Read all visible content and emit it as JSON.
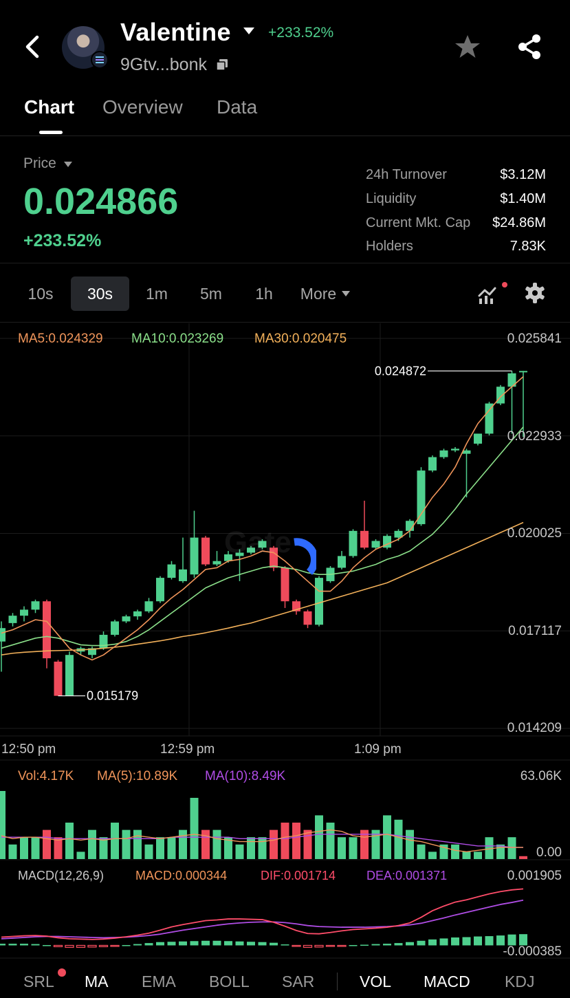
{
  "header": {
    "token_name": "Valentine",
    "change": "+233.52%",
    "address": "9Gtv...bonk"
  },
  "tabs": [
    "Chart",
    "Overview",
    "Data"
  ],
  "price": {
    "label": "Price",
    "value": "0.024866",
    "change": "+233.52%"
  },
  "stats": [
    {
      "label": "24h Turnover",
      "value": "$3.12M"
    },
    {
      "label": "Liquidity",
      "value": "$1.40M"
    },
    {
      "label": "Current Mkt. Cap",
      "value": "$24.86M"
    },
    {
      "label": "Holders",
      "value": "7.83K"
    }
  ],
  "intervals": [
    "10s",
    "30s",
    "1m",
    "5m",
    "1h",
    "More"
  ],
  "selected_interval": "30s",
  "ma_legend": {
    "ma5": "MA5:0.024329",
    "ma10": "MA10:0.023269",
    "ma30": "MA30:0.020475"
  },
  "price_axis": [
    "0.025841",
    "0.022933",
    "0.020025",
    "0.017117",
    "0.014209"
  ],
  "high_marker": "0.024872",
  "low_marker": "0.015179",
  "time_axis": [
    "12:50 pm",
    "12:59 pm",
    "1:09 pm"
  ],
  "watermark": "Gate",
  "volume_legend": {
    "vol": "Vol:4.17K",
    "ma5": "MA(5):10.89K",
    "ma10": "MA(10):8.49K",
    "max": "63.06K",
    "min": "0.00"
  },
  "macd_legend": {
    "name": "MACD(12,26,9)",
    "macd": "MACD:0.000344",
    "dif": "DIF:0.001714",
    "dea": "DEA:0.001371",
    "max": "0.001905",
    "min": "-0.000385"
  },
  "bottom_indicators": [
    "SRL",
    "MA",
    "EMA",
    "BOLL",
    "SAR",
    "VOL",
    "MACD",
    "KDJ"
  ],
  "colors": {
    "up": "#4fd08e",
    "down": "#ef4b5b",
    "ma5": "#f0955a",
    "ma10": "#8be08a",
    "ma30": "#f3b15a",
    "vol_ma10": "#b04de6",
    "dif": "#ff4d6a",
    "dea": "#b04de6"
  },
  "chart_data": {
    "type": "candlestick",
    "title": "",
    "ylim": [
      0.014209,
      0.025841
    ],
    "y_ticks": [
      0.025841,
      0.022933,
      0.020025,
      0.017117,
      0.014209
    ],
    "x_ticks": [
      "12:50 pm",
      "12:59 pm",
      "1:09 pm"
    ],
    "candles": [
      {
        "open": 0.0168,
        "close": 0.0172,
        "high": 0.0174,
        "low": 0.0159
      },
      {
        "open": 0.01735,
        "close": 0.01757,
        "high": 0.01765,
        "low": 0.01725
      },
      {
        "open": 0.01757,
        "close": 0.01775,
        "high": 0.01785,
        "low": 0.0174
      },
      {
        "open": 0.01775,
        "close": 0.018,
        "high": 0.01805,
        "low": 0.01765
      },
      {
        "open": 0.018,
        "close": 0.0163,
        "high": 0.01805,
        "low": 0.016
      },
      {
        "open": 0.0162,
        "close": 0.01518,
        "high": 0.01625,
        "low": 0.01518
      },
      {
        "open": 0.01518,
        "close": 0.0164,
        "high": 0.0165,
        "low": 0.01518
      },
      {
        "open": 0.0165,
        "close": 0.0166,
        "high": 0.01665,
        "low": 0.0164
      },
      {
        "open": 0.0164,
        "close": 0.0166,
        "high": 0.01665,
        "low": 0.0163
      },
      {
        "open": 0.0166,
        "close": 0.017,
        "high": 0.0171,
        "low": 0.01655
      },
      {
        "open": 0.017,
        "close": 0.0174,
        "high": 0.01745,
        "low": 0.01695
      },
      {
        "open": 0.0174,
        "close": 0.01755,
        "high": 0.0176,
        "low": 0.01735
      },
      {
        "open": 0.01755,
        "close": 0.0177,
        "high": 0.01775,
        "low": 0.01745
      },
      {
        "open": 0.0177,
        "close": 0.018,
        "high": 0.0181,
        "low": 0.01765
      },
      {
        "open": 0.018,
        "close": 0.0187,
        "high": 0.01875,
        "low": 0.01795
      },
      {
        "open": 0.0187,
        "close": 0.0191,
        "high": 0.0192,
        "low": 0.01865
      },
      {
        "open": 0.0186,
        "close": 0.01895,
        "high": 0.0199,
        "low": 0.01855
      },
      {
        "open": 0.0188,
        "close": 0.0199,
        "high": 0.0207,
        "low": 0.0187
      },
      {
        "open": 0.0199,
        "close": 0.0191,
        "high": 0.01995,
        "low": 0.01905
      },
      {
        "open": 0.0191,
        "close": 0.0192,
        "high": 0.0195,
        "low": 0.01905
      },
      {
        "open": 0.0192,
        "close": 0.0194,
        "high": 0.0195,
        "low": 0.01915
      },
      {
        "open": 0.01935,
        "close": 0.01945,
        "high": 0.01955,
        "low": 0.0186
      },
      {
        "open": 0.01945,
        "close": 0.0196,
        "high": 0.01965,
        "low": 0.0194
      },
      {
        "open": 0.0196,
        "close": 0.0198,
        "high": 0.01985,
        "low": 0.01955
      },
      {
        "open": 0.0196,
        "close": 0.019,
        "high": 0.01965,
        "low": 0.0189
      },
      {
        "open": 0.019,
        "close": 0.018,
        "high": 0.01905,
        "low": 0.0178
      },
      {
        "open": 0.018,
        "close": 0.0177,
        "high": 0.01805,
        "low": 0.0176
      },
      {
        "open": 0.0177,
        "close": 0.0173,
        "high": 0.01775,
        "low": 0.0172
      },
      {
        "open": 0.0173,
        "close": 0.0187,
        "high": 0.01875,
        "low": 0.01725
      },
      {
        "open": 0.0186,
        "close": 0.019,
        "high": 0.01905,
        "low": 0.01855
      },
      {
        "open": 0.019,
        "close": 0.01935,
        "high": 0.0195,
        "low": 0.01895
      },
      {
        "open": 0.01935,
        "close": 0.0201,
        "high": 0.02015,
        "low": 0.0193
      },
      {
        "open": 0.0201,
        "close": 0.0196,
        "high": 0.021,
        "low": 0.01955
      },
      {
        "open": 0.0196,
        "close": 0.0198,
        "high": 0.01985,
        "low": 0.01955
      },
      {
        "open": 0.0196,
        "close": 0.01995,
        "high": 0.02,
        "low": 0.01955
      },
      {
        "open": 0.0199,
        "close": 0.0201,
        "high": 0.02015,
        "low": 0.0198
      },
      {
        "open": 0.0201,
        "close": 0.0204,
        "high": 0.02045,
        "low": 0.0199
      },
      {
        "open": 0.0203,
        "close": 0.0219,
        "high": 0.022,
        "low": 0.02025
      },
      {
        "open": 0.0219,
        "close": 0.0223,
        "high": 0.02235,
        "low": 0.02185
      },
      {
        "open": 0.0223,
        "close": 0.0225,
        "high": 0.02255,
        "low": 0.02225
      },
      {
        "open": 0.0225,
        "close": 0.02255,
        "high": 0.0226,
        "low": 0.02245
      },
      {
        "open": 0.0224,
        "close": 0.0225,
        "high": 0.02255,
        "low": 0.0211
      },
      {
        "open": 0.0227,
        "close": 0.023,
        "high": 0.023,
        "low": 0.02265
      },
      {
        "open": 0.023,
        "close": 0.0239,
        "high": 0.02395,
        "low": 0.02295
      },
      {
        "open": 0.0239,
        "close": 0.0244,
        "high": 0.02445,
        "low": 0.02385
      },
      {
        "open": 0.0244,
        "close": 0.0248,
        "high": 0.02487,
        "low": 0.023
      },
      {
        "open": 0.02487,
        "close": 0.02487,
        "high": 0.02487,
        "low": 0.0229
      }
    ],
    "ma5": [
      0.01705,
      0.01715,
      0.0173,
      0.01745,
      0.0174,
      0.017,
      0.0166,
      0.0164,
      0.01625,
      0.0164,
      0.01665,
      0.0169,
      0.01715,
      0.01745,
      0.0178,
      0.0181,
      0.01835,
      0.01865,
      0.01895,
      0.019,
      0.0192,
      0.01925,
      0.01935,
      0.0195,
      0.01945,
      0.0192,
      0.0189,
      0.0186,
      0.0183,
      0.0183,
      0.0186,
      0.019,
      0.0193,
      0.01955,
      0.0197,
      0.01985,
      0.0201,
      0.0206,
      0.0211,
      0.0215,
      0.022,
      0.0227,
      0.0233,
      0.0237,
      0.0241,
      0.0244,
      0.0247
    ],
    "ma10": [
      0.0166,
      0.0167,
      0.0168,
      0.0169,
      0.01695,
      0.0169,
      0.0168,
      0.0167,
      0.01668,
      0.01668,
      0.01672,
      0.0168,
      0.01695,
      0.01715,
      0.0174,
      0.01765,
      0.0179,
      0.01815,
      0.0184,
      0.01855,
      0.0187,
      0.0188,
      0.0189,
      0.019,
      0.01905,
      0.019,
      0.01895,
      0.01885,
      0.0188,
      0.0188,
      0.01885,
      0.0189,
      0.019,
      0.0191,
      0.01925,
      0.01935,
      0.0195,
      0.01975,
      0.02,
      0.02035,
      0.02075,
      0.0212,
      0.0216,
      0.022,
      0.0224,
      0.0228,
      0.0232
    ],
    "ma30": [
      0.0164,
      0.01645,
      0.01648,
      0.0165,
      0.01652,
      0.01653,
      0.01654,
      0.01655,
      0.01657,
      0.0166,
      0.01663,
      0.01667,
      0.01672,
      0.01677,
      0.01682,
      0.01688,
      0.01695,
      0.017,
      0.01706,
      0.01713,
      0.0172,
      0.01728,
      0.01735,
      0.01745,
      0.01755,
      0.01765,
      0.01775,
      0.01785,
      0.01795,
      0.01805,
      0.01815,
      0.01825,
      0.01835,
      0.01845,
      0.01855,
      0.0187,
      0.01885,
      0.019,
      0.01915,
      0.0193,
      0.01945,
      0.0196,
      0.01975,
      0.0199,
      0.02005,
      0.0202,
      0.02035
    ],
    "volume": {
      "ylim": [
        0,
        63.06
      ],
      "values": [
        55,
        10,
        15,
        15,
        20,
        15,
        25,
        5,
        20,
        15,
        25,
        20,
        20,
        10,
        15,
        15,
        20,
        42,
        20,
        20,
        15,
        10,
        15,
        15,
        20,
        25,
        25,
        20,
        30,
        25,
        15,
        15,
        20,
        20,
        30,
        27,
        20,
        10,
        5,
        10,
        10,
        5,
        5,
        15,
        10,
        15,
        2
      ],
      "up": [
        true,
        true,
        true,
        true,
        false,
        false,
        true,
        true,
        true,
        true,
        true,
        true,
        true,
        true,
        true,
        true,
        true,
        true,
        false,
        true,
        true,
        true,
        true,
        true,
        false,
        false,
        false,
        false,
        true,
        true,
        true,
        true,
        false,
        true,
        true,
        true,
        true,
        true,
        true,
        true,
        true,
        true,
        true,
        true,
        true,
        true,
        false
      ],
      "ma5": [
        16,
        14,
        15,
        15,
        14,
        13,
        14,
        13,
        14,
        13,
        14,
        14,
        16,
        15,
        14,
        15,
        16,
        17,
        16,
        14,
        13,
        12,
        12,
        12,
        13,
        15,
        16,
        18,
        19,
        20,
        19,
        16,
        15,
        16,
        17,
        15,
        13,
        12,
        10,
        8,
        6,
        5,
        6,
        7,
        8,
        8,
        8
      ],
      "ma10": [
        15,
        15,
        15,
        15,
        15,
        14,
        14,
        14,
        14,
        14,
        14,
        14,
        14,
        14,
        14,
        15,
        15,
        15,
        15,
        15,
        15,
        14,
        14,
        14,
        14,
        14,
        15,
        16,
        17,
        17,
        17,
        17,
        17,
        17,
        17,
        16,
        15,
        14,
        13,
        12,
        11,
        10,
        9,
        9,
        9,
        8,
        8
      ]
    },
    "macd": {
      "ylim": [
        -0.000385,
        0.001905
      ],
      "hist": [
        5e-05,
        5e-05,
        5e-05,
        4e-05,
        1e-05,
        -4e-05,
        -6e-05,
        -6e-05,
        -5e-05,
        -4e-05,
        -2e-05,
        1e-05,
        4e-05,
        7e-05,
        0.0001,
        0.00011,
        0.00012,
        0.00013,
        0.00014,
        0.00014,
        0.00013,
        0.00012,
        0.00011,
        0.0001,
        8e-05,
        3e-05,
        -3e-05,
        -6e-05,
        -5e-05,
        -3e-05,
        -1e-05,
        1e-05,
        2e-05,
        4e-05,
        5e-05,
        7e-05,
        0.0001,
        0.00014,
        0.00018,
        0.00021,
        0.00024,
        0.00025,
        0.00027,
        0.00028,
        0.0003,
        0.00033,
        0.00034
      ],
      "dif": [
        0.00025,
        0.00027,
        0.00029,
        0.0003,
        0.00028,
        0.00023,
        0.0002,
        0.00019,
        0.00018,
        0.00019,
        0.00022,
        0.00026,
        0.00031,
        0.00037,
        0.00046,
        0.00056,
        0.00063,
        0.00069,
        0.00075,
        0.00077,
        0.0008,
        0.0008,
        0.00079,
        0.00078,
        0.0007,
        0.00058,
        0.00045,
        0.00036,
        0.00035,
        0.00039,
        0.00044,
        0.00048,
        0.0005,
        0.00052,
        0.00055,
        0.0006,
        0.00068,
        0.00085,
        0.00105,
        0.00119,
        0.00131,
        0.00138,
        0.00147,
        0.00156,
        0.00163,
        0.00168,
        0.00171
      ],
      "dea": [
        0.0002,
        0.00022,
        0.00024,
        0.00026,
        0.00027,
        0.00027,
        0.00026,
        0.00025,
        0.00024,
        0.00023,
        0.00024,
        0.00025,
        0.00027,
        0.0003,
        0.00034,
        0.0004,
        0.00046,
        0.00051,
        0.00056,
        0.00061,
        0.00065,
        0.00068,
        0.0007,
        0.00071,
        0.00071,
        0.00069,
        0.00065,
        0.0006,
        0.00057,
        0.00056,
        0.00055,
        0.00055,
        0.00055,
        0.00056,
        0.00057,
        0.00059,
        0.00062,
        0.00067,
        0.00075,
        0.00083,
        0.00092,
        0.001,
        0.00108,
        0.00116,
        0.00124,
        0.0013,
        0.00137
      ]
    }
  }
}
